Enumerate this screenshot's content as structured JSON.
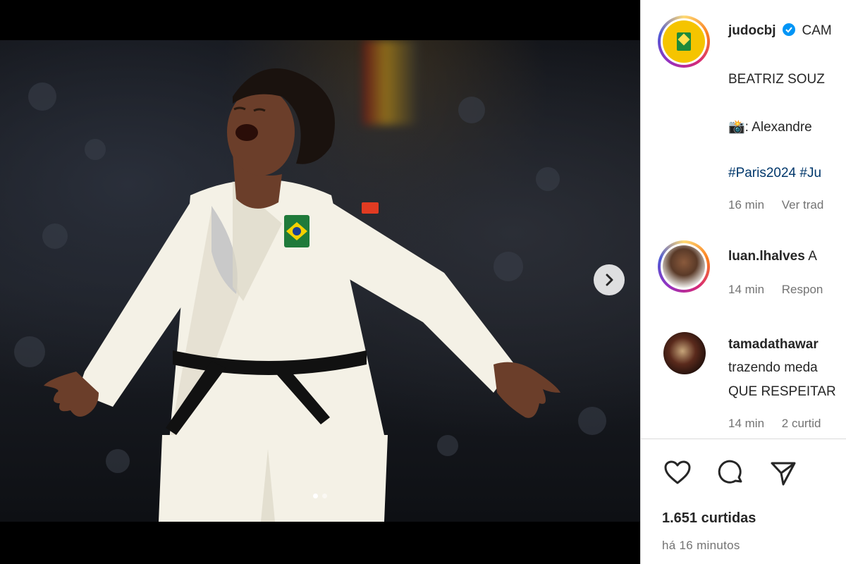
{
  "post": {
    "author": "judocbj",
    "caption_start": "CAM",
    "verified": true,
    "caption_line1": "BEATRIZ SOUZ",
    "photo_credit_emoji": "📸",
    "photo_credit": ": Alexandre",
    "hashtag1": "#Paris2024",
    "hashtag2": "#Ju",
    "time": "16 min",
    "translate_label": "Ver trad"
  },
  "comments": [
    {
      "user": "luan.lhalves",
      "text": "A",
      "time": "14 min",
      "reply_label": "Respon"
    },
    {
      "user": "tamadathawar",
      "text_line1": "trazendo meda",
      "text_line2": "QUE RESPEITAR",
      "time": "14 min",
      "likes_label": "2 curtid"
    }
  ],
  "footer": {
    "likes": "1.651 curtidas",
    "posted": "há 16 minutos"
  },
  "icons": {
    "like": "heart-icon",
    "comment": "comment-icon",
    "share": "share-icon",
    "next": "chevron-right-icon",
    "verified": "verified-badge-icon"
  },
  "carousel": {
    "total": 2,
    "active": 1
  },
  "colors": {
    "verified": "#0095f6",
    "text": "#262626",
    "meta": "#737373",
    "hashtag": "#00376b"
  }
}
